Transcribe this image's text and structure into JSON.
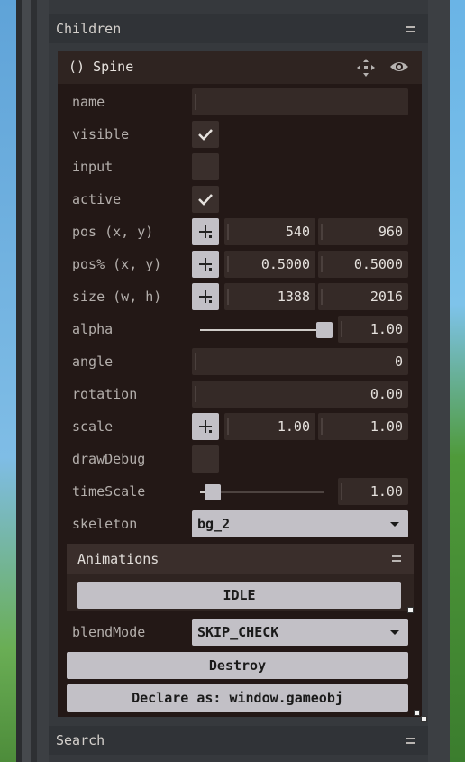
{
  "panels": {
    "children_title": "Children",
    "search_title": "Search"
  },
  "node": {
    "title": "() Spine"
  },
  "labels": {
    "name": "name",
    "visible": "visible",
    "input": "input",
    "active": "active",
    "pos": "pos (x, y)",
    "pos_pct": "pos% (x, y)",
    "size": "size (w, h)",
    "alpha": "alpha",
    "angle": "angle",
    "rotation": "rotation",
    "scale": "scale",
    "drawDebug": "drawDebug",
    "timeScale": "timeScale",
    "skeleton": "skeleton",
    "blendMode": "blendMode"
  },
  "values": {
    "name": "",
    "visible": true,
    "input": false,
    "active": true,
    "pos_x": "540",
    "pos_y": "960",
    "pos_pct_x": "0.5000",
    "pos_pct_y": "0.5000",
    "size_w": "1388",
    "size_h": "2016",
    "alpha": "1.00",
    "alpha_level": 1.0,
    "angle": "0",
    "rotation": "0.00",
    "scale_x": "1.00",
    "scale_y": "1.00",
    "drawDebug": false,
    "timeScale": "1.00",
    "skeleton": "bg_2",
    "blendMode": "SKIP_CHECK"
  },
  "animations": {
    "title": "Animations",
    "items": [
      "IDLE"
    ]
  },
  "buttons": {
    "destroy": "Destroy",
    "declare": "Declare as: window.gameobj"
  }
}
